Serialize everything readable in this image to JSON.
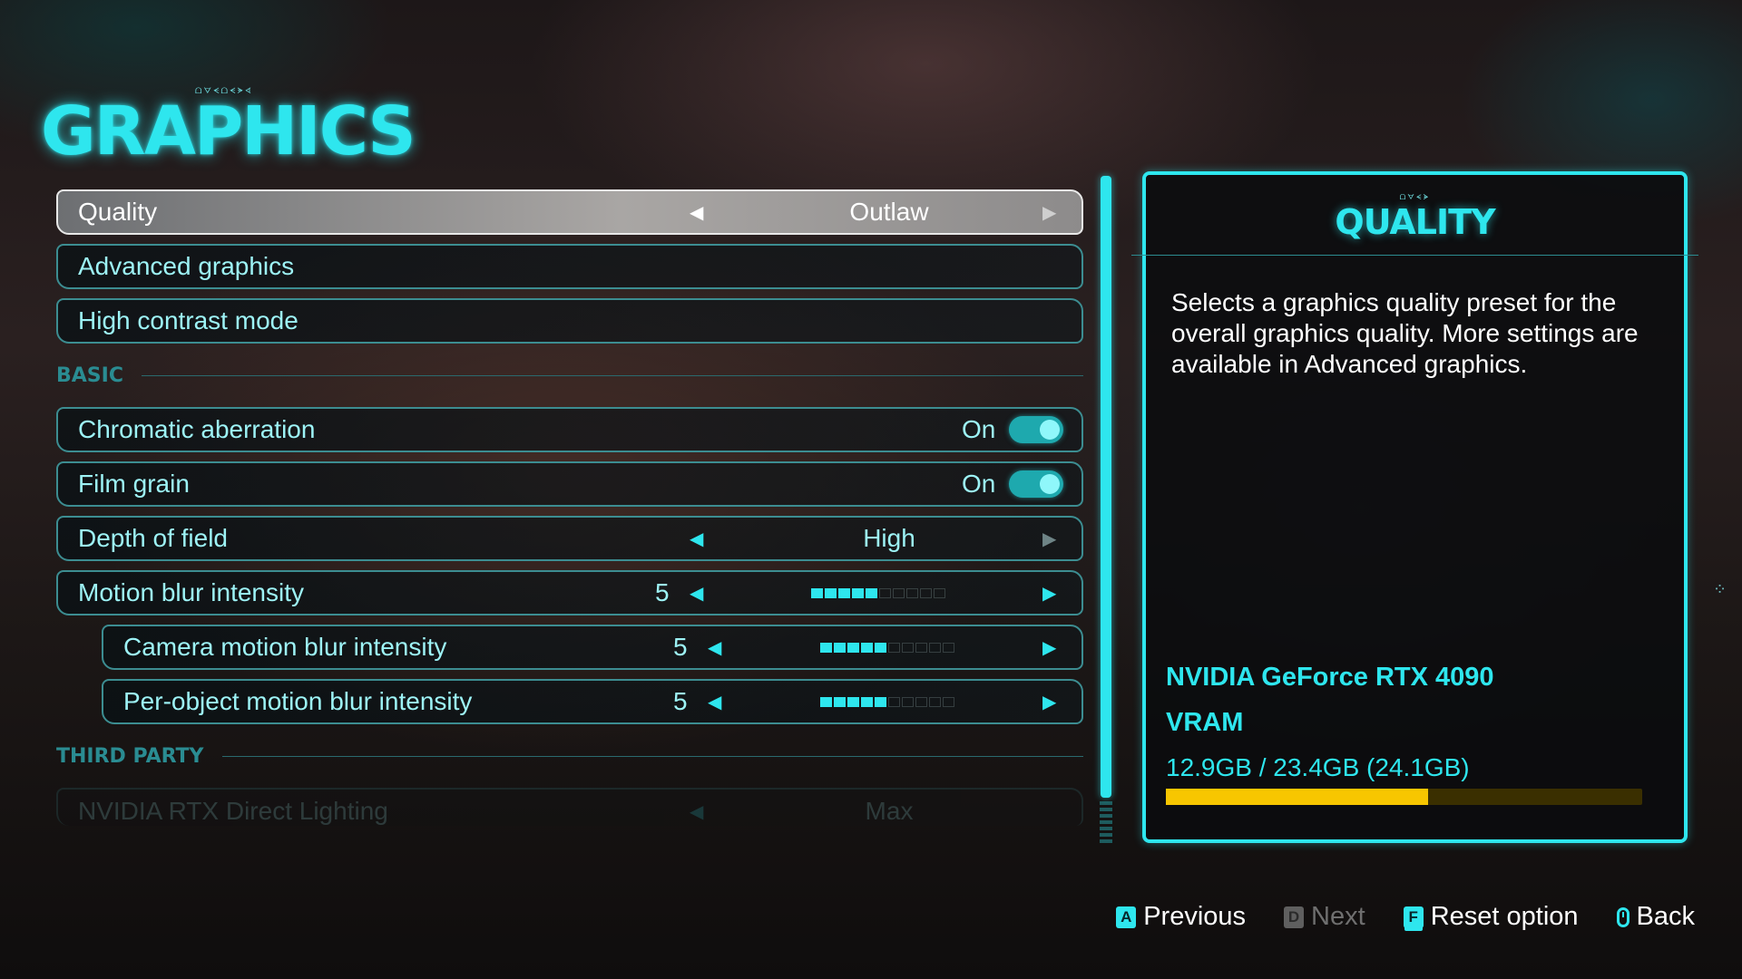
{
  "header": {
    "glyphs": "ᗝᗊᗕᗝᗕᗘᗏ",
    "title": "GRAPHICS"
  },
  "settings": {
    "quality": {
      "label": "Quality",
      "value": "Outlaw"
    },
    "advanced": {
      "label": "Advanced graphics"
    },
    "high_contrast": {
      "label": "High contrast mode"
    },
    "section_basic": "BASIC",
    "chromatic": {
      "label": "Chromatic aberration",
      "state": "On"
    },
    "film_grain": {
      "label": "Film grain",
      "state": "On"
    },
    "depth_of_field": {
      "label": "Depth of field",
      "value": "High"
    },
    "motion_blur": {
      "label": "Motion blur intensity",
      "value": "5",
      "max": 10
    },
    "camera_blur": {
      "label": "Camera motion blur intensity",
      "value": "5",
      "max": 10
    },
    "object_blur": {
      "label": "Per-object motion blur intensity",
      "value": "5",
      "max": 10
    },
    "section_third_party": "THIRD PARTY",
    "rtx_lighting": {
      "label": "NVIDIA RTX Direct Lighting",
      "value": "Max"
    }
  },
  "panel": {
    "glyphs": "ᗝᗊᗕᗘ",
    "title": "QUALITY",
    "description": "Selects a graphics quality preset for the overall graphics quality. More settings are available in Advanced graphics.",
    "gpu": "NVIDIA GeForce RTX 4090",
    "vram_label": "VRAM",
    "vram_value": "12.9GB / 23.4GB (24.1GB)",
    "vram_used_fraction": 0.55
  },
  "footer": {
    "previous": {
      "key": "A",
      "label": "Previous"
    },
    "next": {
      "key": "D",
      "label": "Next"
    },
    "reset": {
      "key": "F",
      "label": "Reset option"
    },
    "back": {
      "label": "Back"
    }
  },
  "icons": {
    "arrow_left": "left-arrow-icon",
    "arrow_right": "right-arrow-icon",
    "mouse": "mouse-icon"
  },
  "colors": {
    "accent": "#2ee6ee",
    "vram_bar": "#f7c600",
    "selected_row": "#a9a6a4"
  }
}
